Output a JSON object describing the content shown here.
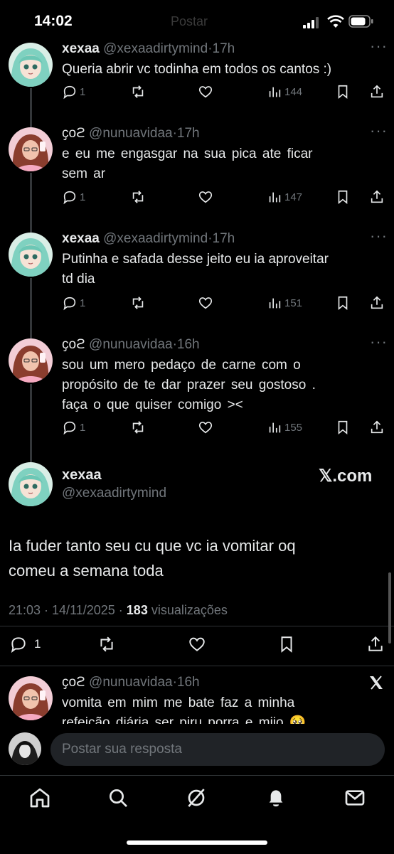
{
  "status_bar": {
    "time": "14:02",
    "ghost_title": "Postar"
  },
  "tweets": [
    {
      "name": "xexaa",
      "handle": "@xexaadirtymind",
      "time": "17h",
      "lines": [
        "Queria abrir vc todinha em todos os cantos :)"
      ],
      "replies": "1",
      "views": "144"
    },
    {
      "name": "ҫoϩ",
      "handle": "@nunuavidaa",
      "time": "17h",
      "lines": [
        "e eu me engasgar na sua pica ate ficar",
        "sem ar"
      ],
      "replies": "1",
      "views": "147"
    },
    {
      "name": "xexaa",
      "handle": "@xexaadirtymind",
      "time": "17h",
      "lines": [
        "Putinha e safada desse jeito eu ia aproveitar",
        "td dia"
      ],
      "replies": "1",
      "views": "151"
    },
    {
      "name": "ҫoϩ",
      "handle": "@nunuavidaa",
      "time": "16h",
      "lines": [
        "sou um mero pedaço de carne com o",
        "propósito de te dar prazer seu gostoso .",
        "faça o que quiser comigo ><"
      ],
      "replies": "1",
      "views": "155"
    }
  ],
  "main_tweet": {
    "name": "xexaa",
    "handle": "@xexaadirtymind",
    "brand": "𝕏.com",
    "lines": [
      "Ia fuder tanto seu cu que vc ia vomitar oq",
      "comeu a semana toda"
    ],
    "datetime": "21:03 · 14/11/2025 · ",
    "views_count": "183",
    "views_label": " visualizações",
    "replies": "1"
  },
  "reply_tweet": {
    "name": "ҫoϩ",
    "handle": "@nunuavidaa",
    "time": "16h",
    "lines": [
      "vomita em mim me bate faz a minha",
      "refeição diária ser piru porra e mijo 🥺"
    ]
  },
  "composer": {
    "placeholder": "Postar sua resposta"
  },
  "tabs": [
    "home-icon",
    "search-icon",
    "grok-icon",
    "notifications-icon",
    "messages-icon"
  ],
  "colors": {
    "background": "#000000",
    "text": "#e7e9ea",
    "muted": "#71767b"
  }
}
